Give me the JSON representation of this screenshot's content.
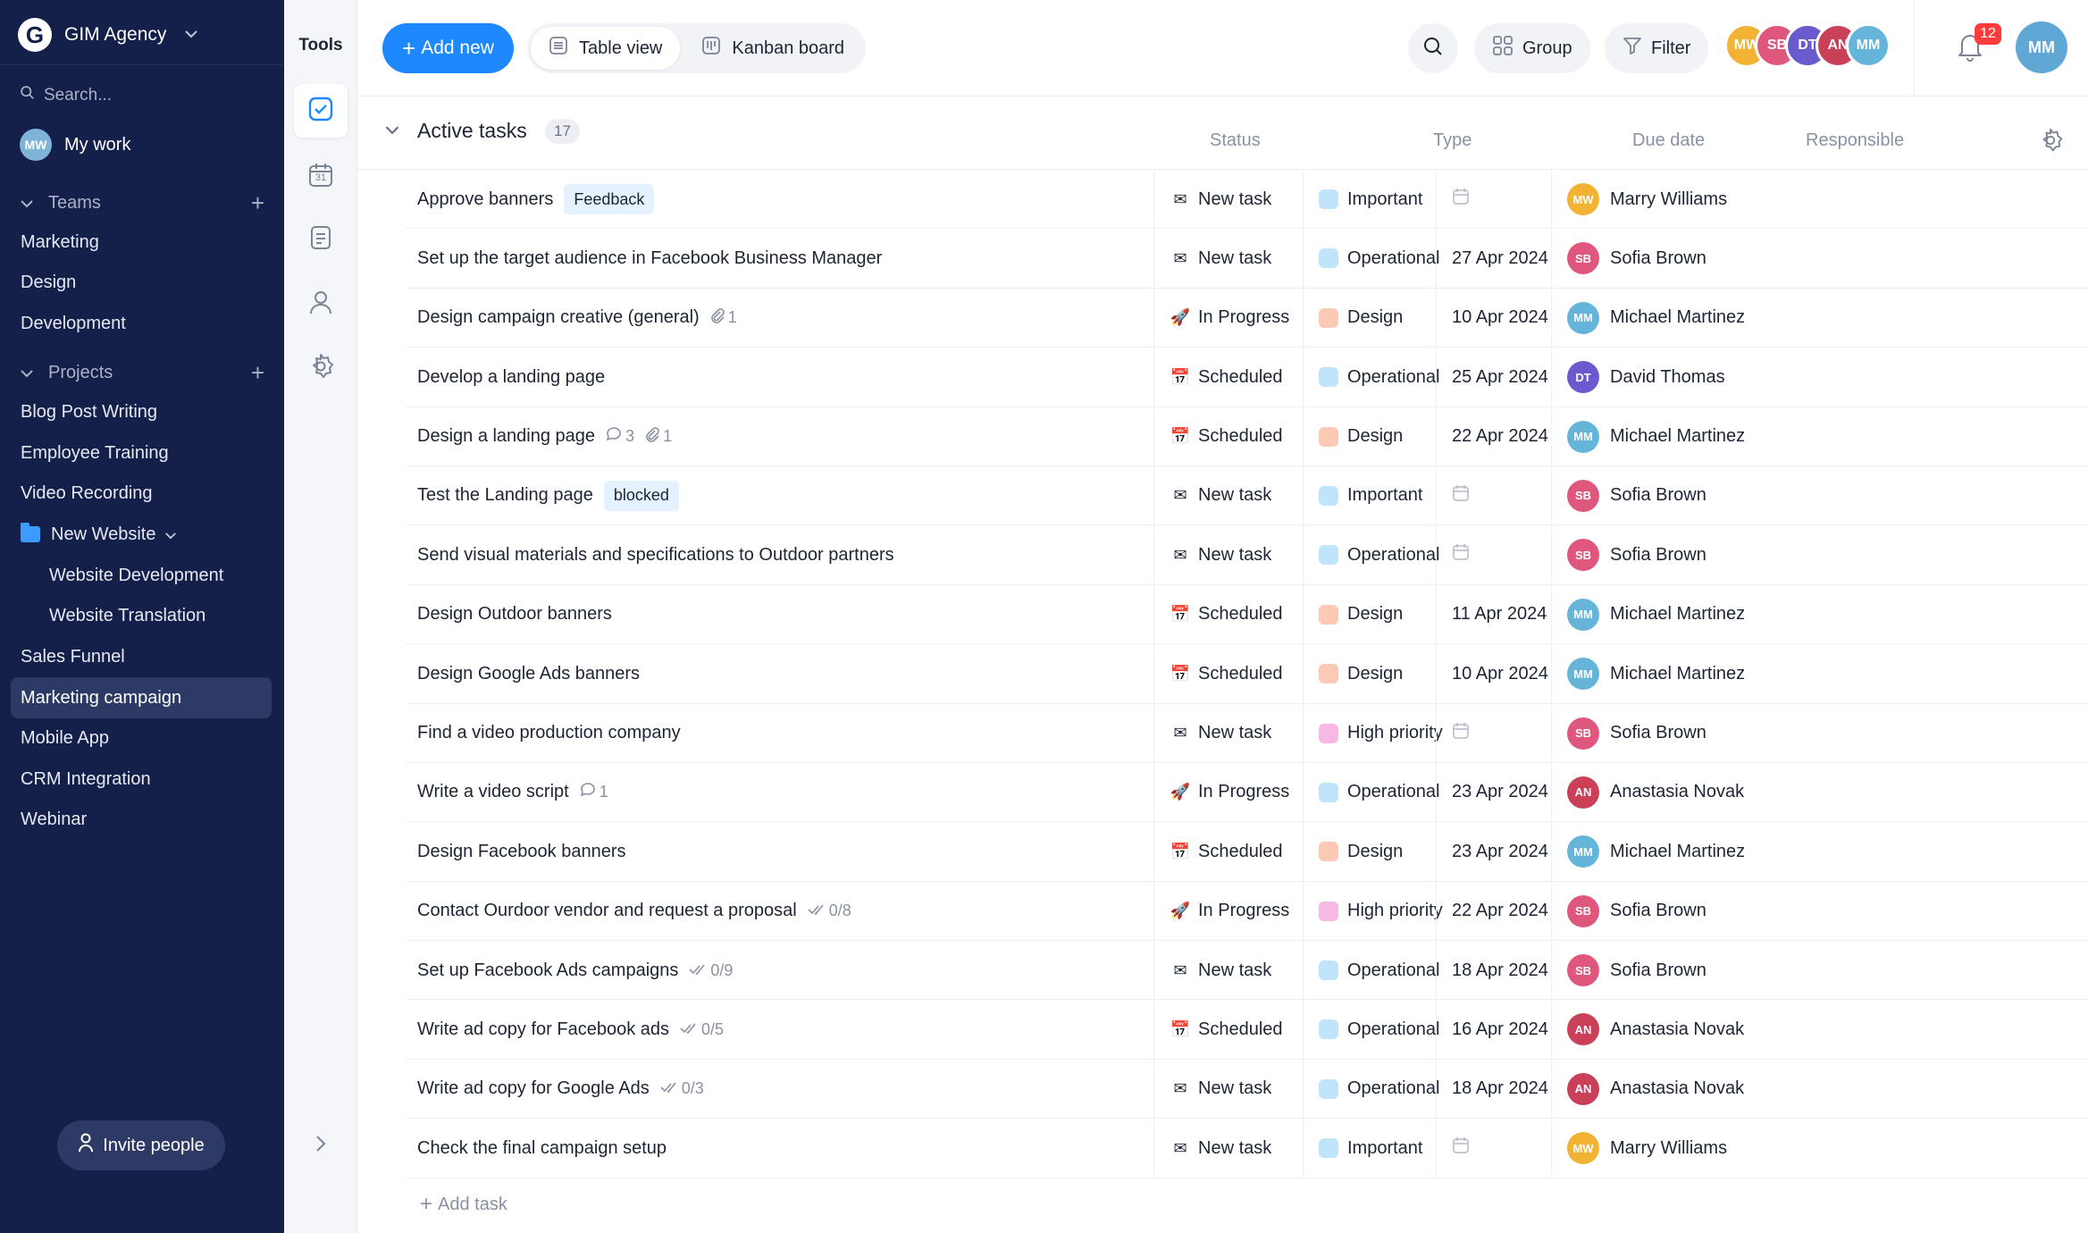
{
  "workspace": {
    "logo": "G",
    "name": "GIM Agency"
  },
  "sidebar": {
    "search_placeholder": "Search...",
    "my_work": "My work",
    "my_work_initials": "MW",
    "teams_label": "Teams",
    "teams": [
      "Marketing",
      "Design",
      "Development"
    ],
    "projects_label": "Projects",
    "projects": [
      "Blog Post Writing",
      "Employee Training",
      "Video Recording"
    ],
    "folder": {
      "name": "New Website",
      "children": [
        "Website Development",
        "Website Translation"
      ]
    },
    "projects_after": [
      "Sales Funnel",
      "Marketing campaign",
      "Mobile App",
      "CRM Integration",
      "Webinar"
    ],
    "active_project": "Marketing campaign",
    "invite": "Invite people"
  },
  "tools": {
    "title": "Tools",
    "items": [
      "tasks-icon",
      "calendar-icon",
      "docs-icon",
      "people-icon",
      "settings-icon"
    ],
    "calendar_day": "31"
  },
  "topbar": {
    "add_new": "Add new",
    "views": [
      "Table view",
      "Kanban board"
    ],
    "active_view": "Table view",
    "group": "Group",
    "filter": "Filter",
    "notifications": "12",
    "members": [
      {
        "initials": "MW",
        "color": "#f2b233"
      },
      {
        "initials": "SB",
        "color": "#e0577e"
      },
      {
        "initials": "DT",
        "color": "#6a5acd"
      },
      {
        "initials": "AN",
        "color": "#c94058"
      },
      {
        "initials": "MM",
        "color": "#64b5d9"
      }
    ],
    "me_initials": "MM"
  },
  "table": {
    "group_title": "Active tasks",
    "count": "17",
    "columns": {
      "status": "Status",
      "type": "Type",
      "due": "Due date",
      "responsible": "Responsible"
    },
    "add_task": "Add task",
    "status_icons": {
      "New task": "✉",
      "In Progress": "🚀",
      "Scheduled": "📅"
    },
    "type_colors": {
      "Important": "#bfe4fb",
      "Operational": "#bfe4fb",
      "Design": "#fcc9b5",
      "High priority": "#f7b8e3"
    },
    "people": {
      "Marry Williams": {
        "initials": "MW",
        "color": "#f2b233"
      },
      "Sofia Brown": {
        "initials": "SB",
        "color": "#e0577e"
      },
      "Michael Martinez": {
        "initials": "MM",
        "color": "#64b5d9"
      },
      "David Thomas": {
        "initials": "DT",
        "color": "#6a5acd"
      },
      "Anastasia Novak": {
        "initials": "AN",
        "color": "#c94058"
      }
    },
    "rows": [
      {
        "name": "Approve banners",
        "tag": "Feedback",
        "status": "New task",
        "type": "Important",
        "due": "",
        "resp": "Marry Williams"
      },
      {
        "name": "Set up the target audience in Facebook Business Manager",
        "status": "New task",
        "type": "Operational",
        "due": "27 Apr 2024",
        "resp": "Sofia Brown"
      },
      {
        "name": "Design campaign creative (general)",
        "attach": "1",
        "status": "In Progress",
        "type": "Design",
        "due": "10 Apr 2024",
        "resp": "Michael Martinez"
      },
      {
        "name": "Develop a landing page",
        "status": "Scheduled",
        "type": "Operational",
        "due": "25 Apr 2024",
        "resp": "David Thomas"
      },
      {
        "name": "Design a landing page",
        "comments": "3",
        "attach": "1",
        "status": "Scheduled",
        "type": "Design",
        "due": "22 Apr 2024",
        "resp": "Michael Martinez"
      },
      {
        "name": "Test the Landing page",
        "tag": "blocked",
        "status": "New task",
        "type": "Important",
        "due": "",
        "resp": "Sofia Brown"
      },
      {
        "name": "Send visual materials and specifications to Outdoor partners",
        "status": "New task",
        "type": "Operational",
        "due": "",
        "resp": "Sofia Brown"
      },
      {
        "name": "Design Outdoor banners",
        "status": "Scheduled",
        "type": "Design",
        "due": "11 Apr 2024",
        "resp": "Michael Martinez"
      },
      {
        "name": "Design Google Ads banners",
        "status": "Scheduled",
        "type": "Design",
        "due": "10 Apr 2024",
        "resp": "Michael Martinez"
      },
      {
        "name": "Find a video production company",
        "status": "New task",
        "type": "High priority",
        "due": "",
        "resp": "Sofia Brown"
      },
      {
        "name": "Write a video script",
        "comments": "1",
        "status": "In Progress",
        "type": "Operational",
        "due": "23 Apr 2024",
        "resp": "Anastasia Novak"
      },
      {
        "name": "Design Facebook banners",
        "status": "Scheduled",
        "type": "Design",
        "due": "23 Apr 2024",
        "resp": "Michael Martinez"
      },
      {
        "name": "Contact Ourdoor vendor and request a proposal",
        "checklist": "0/8",
        "status": "In Progress",
        "type": "High priority",
        "due": "22 Apr 2024",
        "resp": "Sofia Brown"
      },
      {
        "name": "Set up Facebook Ads campaigns",
        "checklist": "0/9",
        "status": "New task",
        "type": "Operational",
        "due": "18 Apr 2024",
        "resp": "Sofia Brown"
      },
      {
        "name": "Write ad copy for Facebook ads",
        "checklist": "0/5",
        "status": "Scheduled",
        "type": "Operational",
        "due": "16 Apr 2024",
        "resp": "Anastasia Novak"
      },
      {
        "name": "Write ad copy for Google Ads",
        "checklist": "0/3",
        "status": "New task",
        "type": "Operational",
        "due": "18 Apr 2024",
        "resp": "Anastasia Novak"
      },
      {
        "name": "Check the final campaign setup",
        "status": "New task",
        "type": "Important",
        "due": "",
        "resp": "Marry Williams"
      }
    ]
  }
}
